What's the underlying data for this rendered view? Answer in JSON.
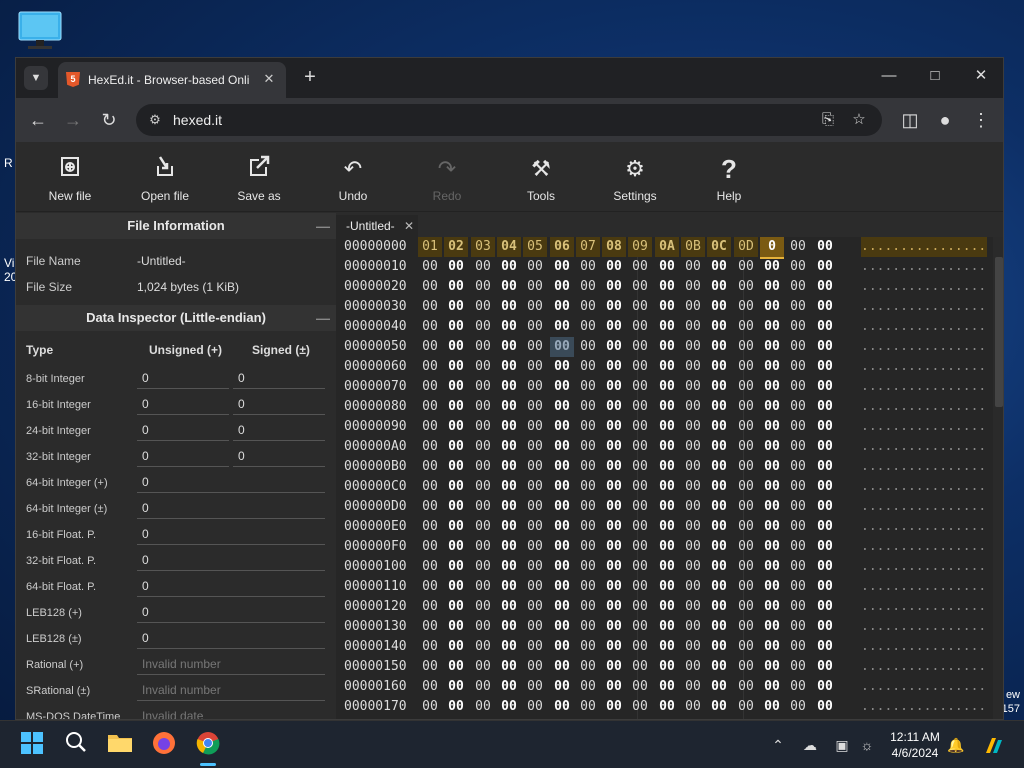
{
  "desktop": {
    "left_texts": [
      "R",
      "Vi",
      "20"
    ],
    "right_texts": [
      "ew",
      "157"
    ]
  },
  "browser": {
    "tab_title": "HexEd.it - Browser-based Onli",
    "url": "hexed.it"
  },
  "toolbar": {
    "new_file": "New file",
    "open_file": "Open file",
    "save_as": "Save as",
    "undo": "Undo",
    "redo": "Redo",
    "tools": "Tools",
    "settings": "Settings",
    "help": "Help"
  },
  "file_info": {
    "title": "File Information",
    "file_name_label": "File Name",
    "file_name_value": "-Untitled-",
    "file_size_label": "File Size",
    "file_size_value": "1,024 bytes (1 KiB)"
  },
  "inspector": {
    "title": "Data Inspector (Little-endian)",
    "col_type": "Type",
    "col_unsigned": "Unsigned (+)",
    "col_signed": "Signed (±)",
    "rows": [
      {
        "label": "8-bit Integer",
        "unsigned": "0",
        "signed": "0"
      },
      {
        "label": "16-bit Integer",
        "unsigned": "0",
        "signed": "0"
      },
      {
        "label": "24-bit Integer",
        "unsigned": "0",
        "signed": "0"
      },
      {
        "label": "32-bit Integer",
        "unsigned": "0",
        "signed": "0"
      },
      {
        "label": "64-bit Integer (+)",
        "value": "0"
      },
      {
        "label": "64-bit Integer (±)",
        "value": "0"
      },
      {
        "label": "16-bit Float. P.",
        "value": "0"
      },
      {
        "label": "32-bit Float. P.",
        "value": "0"
      },
      {
        "label": "64-bit Float. P.",
        "value": "0"
      },
      {
        "label": "LEB128 (+)",
        "value": "0"
      },
      {
        "label": "LEB128 (±)",
        "value": "0"
      },
      {
        "label": "Rational (+)",
        "placeholder": "Invalid number"
      },
      {
        "label": "SRational (±)",
        "placeholder": "Invalid number"
      },
      {
        "label": "MS-DOS DateTime",
        "placeholder": "Invalid date"
      }
    ]
  },
  "hex": {
    "tab_name": "-Untitled-",
    "offsets": [
      "00000000",
      "00000010",
      "00000020",
      "00000030",
      "00000040",
      "00000050",
      "00000060",
      "00000070",
      "00000080",
      "00000090",
      "000000A0",
      "000000B0",
      "000000C0",
      "000000D0",
      "000000E0",
      "000000F0",
      "00000100",
      "00000110",
      "00000120",
      "00000130",
      "00000140",
      "00000150",
      "00000160",
      "00000170"
    ],
    "first_row_bytes": [
      "01",
      "02",
      "03",
      "04",
      "05",
      "06",
      "07",
      "08",
      "09",
      "0A",
      "0B",
      "0C",
      "0D",
      "0",
      "00",
      "00"
    ],
    "zero_byte": "00",
    "ascii_row": "................"
  },
  "taskbar": {
    "time": "12:11 AM",
    "date": "4/6/2024"
  }
}
